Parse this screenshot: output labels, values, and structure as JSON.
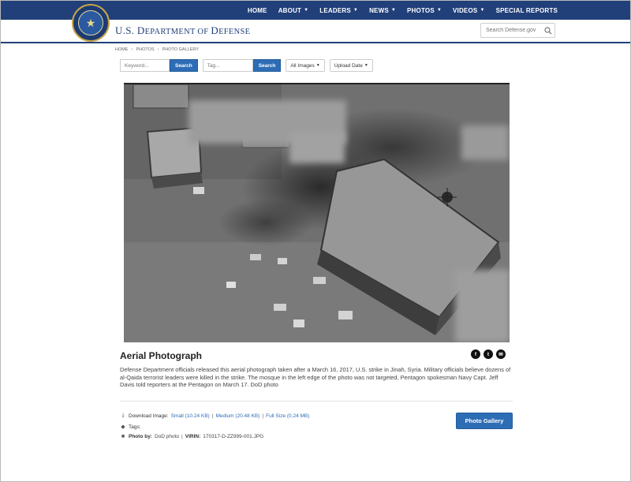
{
  "header": {
    "nav": [
      {
        "label": "HOME",
        "dropdown": false
      },
      {
        "label": "ABOUT",
        "dropdown": true
      },
      {
        "label": "LEADERS",
        "dropdown": true
      },
      {
        "label": "NEWS",
        "dropdown": true
      },
      {
        "label": "PHOTOS",
        "dropdown": true
      },
      {
        "label": "VIDEOS",
        "dropdown": true
      },
      {
        "label": "SPECIAL REPORTS",
        "dropdown": false
      }
    ],
    "brand_initial_1": "U.S. D",
    "brand_rest_1": "EPARTMENT OF ",
    "brand_initial_2": "D",
    "brand_rest_2": "EFENSE",
    "search_placeholder": "Search Defense.gov"
  },
  "breadcrumb": [
    "HOME",
    "PHOTOS",
    "PHOTO GALLERY"
  ],
  "filters": {
    "keyword_placeholder": "Keyword...",
    "keyword_search": "Search",
    "tag_placeholder": "Tag...",
    "tag_search": "Search",
    "images_dropdown": "All Images",
    "date_dropdown": "Upload Date"
  },
  "photo": {
    "title": "Aerial Photograph",
    "caption": "Defense Department officials released this aerial photograph taken after a March 16, 2017, U.S. strike in Jinah, Syria. Military officials believe dozens of al-Qaida terrorist leaders were killed in the strike. The mosque in the left edge of the photo was not targeted, Pentagon spokesman Navy Capt. Jeff Davis told reporters at the Pentagon on March 17. DoD photo"
  },
  "social": [
    {
      "icon": "facebook-icon",
      "glyph": "f"
    },
    {
      "icon": "twitter-icon",
      "glyph": "t"
    },
    {
      "icon": "email-icon",
      "glyph": "✉"
    }
  ],
  "download": {
    "label": "Download Image:",
    "small": "Small (10.24 KB)",
    "medium": "Medium (20.48 KB)",
    "full": "Full Size (0.24 MB)"
  },
  "tags": {
    "label": "Tags:"
  },
  "credit": {
    "photo_by_label": "Photo by:",
    "photo_by": "DoD photo",
    "virin_label": "VIRIN:",
    "virin": "170317-D-ZZ999-001.JPG"
  },
  "gallery_button": "Photo Gallery",
  "colors": {
    "brand_blue": "#21407a",
    "button_blue": "#2d6db5"
  }
}
